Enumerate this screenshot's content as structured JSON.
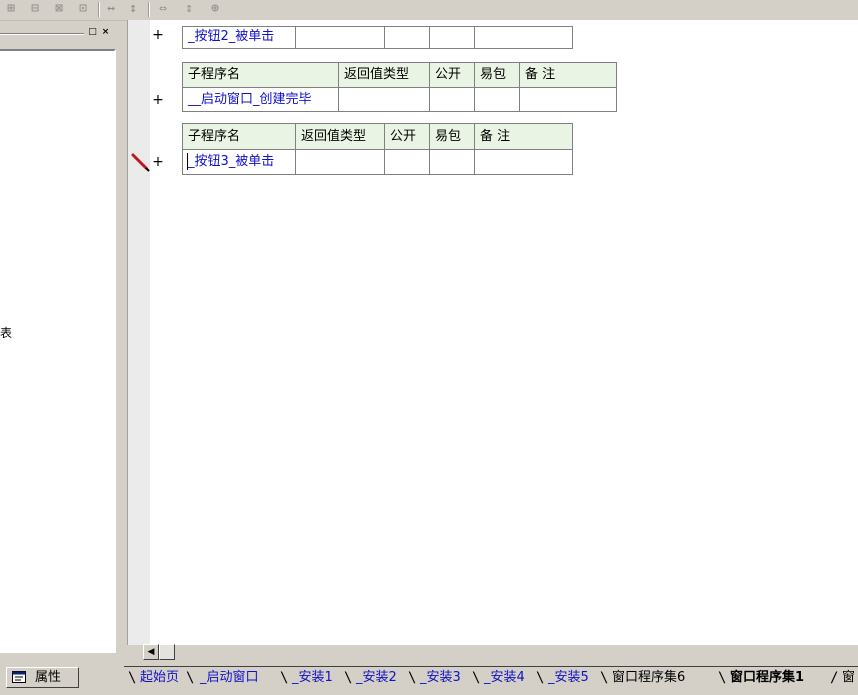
{
  "toolbar": {
    "icons": [
      "table-insert-icon",
      "table-split-icon",
      "table-merge-icon",
      "table-columns-icon",
      "align-width-icon",
      "align-height-icon",
      "width-fit-icon",
      "height-fit-icon",
      "center-icon"
    ]
  },
  "left_panel": {
    "fragment_text": "表",
    "maximize_glyph": "□",
    "close_glyph": "×"
  },
  "editor": {
    "rows": [
      {
        "cells": [
          "_按钮2_被单击",
          "",
          "",
          "",
          "",
          ""
        ]
      },
      {
        "header": [
          "子程序名",
          "返回值类型",
          "公开",
          "易包",
          "备 注"
        ]
      },
      {
        "cells": [
          "__启动窗口_创建完毕",
          "",
          "",
          "",
          ""
        ]
      },
      {
        "header": [
          "子程序名",
          "返回值类型",
          "公开",
          "易包",
          "备 注"
        ]
      },
      {
        "cells": [
          "_按钮3_被单击",
          "",
          "",
          "",
          ""
        ]
      }
    ],
    "plus_glyph": "+"
  },
  "bottom": {
    "props_label": "属性",
    "scroll_left_glyph": "◀",
    "tabs": [
      {
        "label": "起始页",
        "state": "link"
      },
      {
        "label": "_启动窗口",
        "state": "link"
      },
      {
        "label": "_安装1",
        "state": "link"
      },
      {
        "label": "_安装2",
        "state": "link"
      },
      {
        "label": "_安装3",
        "state": "link"
      },
      {
        "label": "_安装4",
        "state": "link"
      },
      {
        "label": "_安装5",
        "state": "link"
      },
      {
        "label": "窗口程序集6",
        "state": "plain"
      },
      {
        "label": "窗口程序集1",
        "state": "active"
      },
      {
        "label": "窗",
        "state": "plain"
      }
    ]
  },
  "colors": {
    "link": "#1010c8",
    "header_bg": "#eaf4e4",
    "chrome": "#d4d0c8"
  }
}
